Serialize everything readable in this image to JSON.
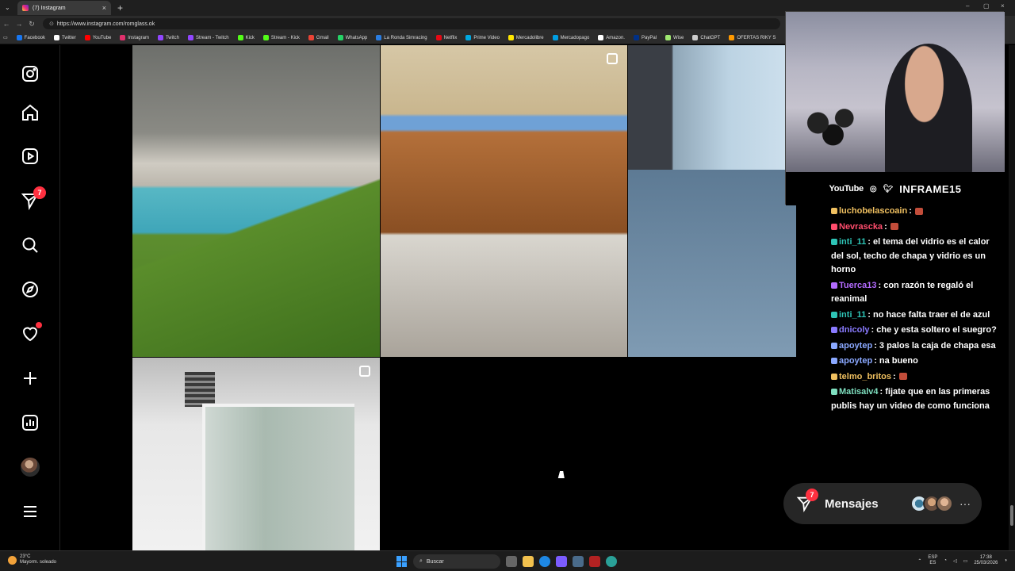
{
  "browser": {
    "tab_title": "(7) Instagram",
    "new_tab": "+",
    "url": "https://www.instagram.com/romglass.ok",
    "bookmarks": [
      {
        "label": "Facebook",
        "color": "#1877f2"
      },
      {
        "label": "Twitter",
        "color": "#ffffff"
      },
      {
        "label": "YouTube",
        "color": "#ff0000"
      },
      {
        "label": "Instagram",
        "color": "#e1306c"
      },
      {
        "label": "Twitch",
        "color": "#9146ff"
      },
      {
        "label": "Stream - Twitch",
        "color": "#9146ff"
      },
      {
        "label": "Kick",
        "color": "#53fc18"
      },
      {
        "label": "Stream - Kick",
        "color": "#53fc18"
      },
      {
        "label": "Gmail",
        "color": "#ea4335"
      },
      {
        "label": "WhatsApp",
        "color": "#25d366"
      },
      {
        "label": "La Ronda Simracing",
        "color": "#2a7de1"
      },
      {
        "label": "Netflix",
        "color": "#e50914"
      },
      {
        "label": "Prime Video",
        "color": "#00a8e1"
      },
      {
        "label": "Mercadolibre",
        "color": "#ffe600"
      },
      {
        "label": "Mercadopago",
        "color": "#009ee3"
      },
      {
        "label": "Amazon.",
        "color": "#ffffff"
      },
      {
        "label": "PayPal",
        "color": "#003087"
      },
      {
        "label": "Wise",
        "color": "#9fe870"
      },
      {
        "label": "ChatGPT",
        "color": "#cccccc"
      },
      {
        "label": "OFERTAS RIKY S",
        "color": "#ff9900"
      }
    ]
  },
  "sidebar": {
    "notifications_badge": "7"
  },
  "messages": {
    "label": "Mensajes",
    "badge": "7",
    "more": "···"
  },
  "overlay": {
    "youtube": "YouTube",
    "brand": "INFRAME15"
  },
  "chat": [
    {
      "user": "luchobelascoain",
      "text": ":",
      "color": "#f0c060"
    },
    {
      "user": "Nevrascka",
      "text": ":",
      "color": "#ff4d6d"
    },
    {
      "user": "inti_11",
      "text": ": el tema del vidrio es el calor del sol, techo de chapa y vidrio es un horno",
      "color": "#2ec4b6"
    },
    {
      "user": "Tuerca13",
      "text": ": con razón te regaló el reanimal",
      "color": "#b36bff"
    },
    {
      "user": "inti_11",
      "text": ": no hace falta traer el de azul",
      "color": "#2ec4b6"
    },
    {
      "user": "dnicoly",
      "text": ": che y esta soltero el suegro?",
      "color": "#8a7bff"
    },
    {
      "user": "apoytep",
      "text": ": 3 palos la caja de chapa esa",
      "color": "#8aa8ff"
    },
    {
      "user": "apoytep",
      "text": ": na bueno",
      "color": "#8aa8ff"
    },
    {
      "user": "telmo_britos",
      "text": ":",
      "color": "#f0c060"
    },
    {
      "user": "Matisalv4",
      "text": ": fijate que en las primeras publis hay un video de como funciona",
      "color": "#7fe0c0"
    }
  ],
  "taskbar": {
    "temp": "23°C",
    "weather": "Mayorm. soleado",
    "search": "Buscar",
    "lang1": "ESP",
    "lang2": "ES",
    "time": "17:38",
    "date": "25/03/2026"
  }
}
